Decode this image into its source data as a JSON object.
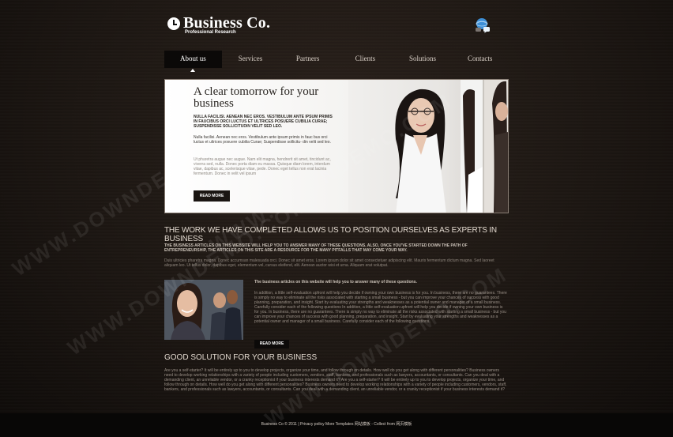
{
  "header": {
    "logo_title": "Business Co.",
    "logo_subtitle": "Professional Research"
  },
  "nav": {
    "items": [
      {
        "label": "About us",
        "active": true
      },
      {
        "label": "Services",
        "active": false
      },
      {
        "label": "Partners",
        "active": false
      },
      {
        "label": "Clients",
        "active": false
      },
      {
        "label": "Solutions",
        "active": false
      },
      {
        "label": "Contacts",
        "active": false
      }
    ]
  },
  "hero": {
    "title": "A clear tomorrow for your business",
    "caps_text": "NULLA FACILISI. AENEAN NEC EROS. VESTIBULUM ANTE IPSUM PRIMIS IN FAUCIBUS ORCI LUCTUS ET ULTRICES POSUERE CUBILIA CURAE; SUSPENDISSE SOLLICITUDIN VELIT SED LEO.",
    "paragraph1": "Nulla facilisi. Aenean nec eros. Vestibulum ante ipsum primis in fauc bus orci luctus et ultrices posuere cubilia Curae; Suspendisse sollicitu- din velit sed leo.",
    "paragraph2": "Ut pharetra augue nec augue. Nam elit magna, hendrerit sit amet, tincidunt ac, viverra sed, nulla. Donec porta diam eu massa. Quisque diam lorem, interdum vitae, dapibus ac, scelerisque vitae, pede. Donec eget tellus non erat lacinia fermentum. Donec in velit vel ipsum",
    "button": "READ MORE"
  },
  "work": {
    "heading": "THE WORK WE HAVE COMPLETED ALLOWS US TO POSITION OURSELVES AS EXPERTS IN BUSINESS",
    "caps_text": "THE BUSINESS ARTICLES ON THIS WEBSITE WILL HELP YOU TO ANSWER MANY OF THESE QUESTIONS. ALSO, ONCE YOU'VE STARTED DOWN THE PATH OF ENTREPRENEURSHIP, THE ARTICLES ON THIS SITE ARE A RESOURCE FOR THE MANY PITFALLS THAT MAY COME YOUR WAY.",
    "small_text": "Duis ultricies pharetra magna. Donec accumsan malesuada orci. Donec sit amet eros. Lorem ipsum dolor sit amet consectetuer adipiscing elit. Mauris fermentum dictum magna. Sed laoreet aliquam leo. Ut tellus dolor, dapibus eget, elementum vel, cursus eleifend, elit. Aenean auctor wisi et urna. Aliquam erat volutpat."
  },
  "article": {
    "title": "The business articles on this website will help you to answer many of these questions.",
    "body": "In addition, a little self-evaluation upfront will help you decide if owning your own business is for you. In business, there are no guarantees. There is simply no way to eliminate all the risks associated with starting a small business - but you can improve your chances of success with good planning, preparation, and insight. Start by evaluating your strengths and weaknesses as a potential owner and manager of a small business. Carefully consider each of the following questions In addition, a little self-evaluation upfront will help you decide if owning your own business is for you. In business, there are no guarantees. There is simply no way to eliminate all the risks associated with starting a small business - but you can improve your chances of success with good planning, preparation, and insight. Start by evaluating your strengths and weaknesses as a potential owner and manager of a small business. Carefully consider each of the following questions.",
    "button": "READ MORE"
  },
  "good": {
    "heading": "GOOD SOLUTION FOR YOUR BUSINESS",
    "text": "Are you a self-starter? It will be entirely up to you to develop projects, organize your time, and follow through on details. How well do you get along with different personalities? Business owners need to develop working relationships with a variety of people including customers, vendors, staff, bankers, and professionals such as lawyers, accountants, or consultants. Can you deal with a demanding client, an unreliable vendor, or a cranky receptionist if your business interests demand it? Are you a self-starter? It will be entirely up to you to develop projects, organize your time, and follow through on details. How well do you get along with different personalities? Business owners need to develop working relationships with a variety of people including customers, vendors, staff, bankers, and professionals such as lawyers, accountants, or consultants. Can you deal with a demanding client, an unreliable vendor, or a cranky receptionist if your business interests demand it?"
  },
  "footer": {
    "text": "Business Co © 2011 | Privacy policy More Templates 网站模板 - Collect from 网页模板"
  },
  "watermark": {
    "text": "WWW.DOWNDEMO.COM"
  },
  "icons": {
    "logo": "clock-icon",
    "top_right": "globe-chat-icon"
  }
}
